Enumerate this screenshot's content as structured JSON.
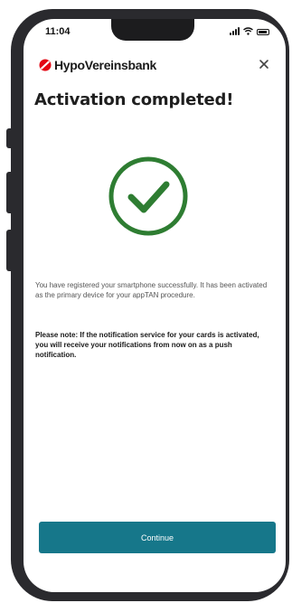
{
  "status_bar": {
    "time": "11:04",
    "icons": [
      "signal-icon",
      "wifi-icon",
      "battery-icon"
    ]
  },
  "header": {
    "logo_text": "HypoVereinsbank",
    "logo_icon": "hvb-logo-icon",
    "close_icon": "close-icon"
  },
  "main": {
    "title": "Activation completed!",
    "success_icon": "check-circle-icon",
    "message": "You have registered your smartphone successfully. It has been activated as the primary device for your appTAN procedure.",
    "note": "Please note: If the notification service for your cards is activated, you will receive your notifications from now on as a push notification."
  },
  "footer": {
    "continue_label": "Continue"
  },
  "colors": {
    "accent": "#16778a",
    "success": "#2e7d32",
    "brand_red": "#e30613"
  }
}
